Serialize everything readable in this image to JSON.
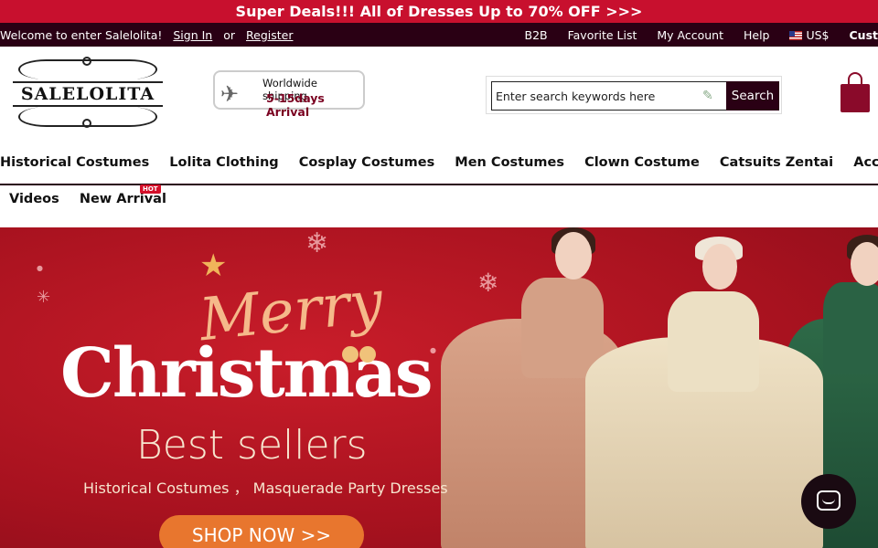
{
  "promo": {
    "text": "Super Deals!!! All of Dresses Up to 70% OFF >>>"
  },
  "topbar": {
    "welcome": "Welcome to enter Salelolita!",
    "sign_in": "Sign In",
    "or": "or",
    "register": "Register",
    "links": [
      "B2B",
      "Favorite List",
      "My Account",
      "Help"
    ],
    "currency": "US$",
    "customer": "Cust"
  },
  "header": {
    "logo_text": "SALELOLITA",
    "shipping_line1": "Worldwide shipping",
    "shipping_line2": "5-15days Arrival",
    "search_placeholder": "Enter search keywords here",
    "search_button": "Search"
  },
  "nav": {
    "row1": [
      "Historical Costumes",
      "Lolita Clothing",
      "Cosplay Costumes",
      "Men Costumes",
      "Clown Costume",
      "Catsuits Zentai",
      "Accessor"
    ],
    "row2": [
      "Videos",
      "New Arrival"
    ],
    "hot_badge": "HOT"
  },
  "banner": {
    "merry": "Merry",
    "christmas": "Christmas",
    "best": "Best sellers",
    "subtitle": "Historical Costumes ， Masquerade Party Dresses",
    "cta": "SHOP NOW >>"
  },
  "colors": {
    "brand_dark": "#2a0014",
    "promo_red": "#c8102e",
    "banner_red": "#a8121f",
    "cta_orange": "#e8762e"
  }
}
